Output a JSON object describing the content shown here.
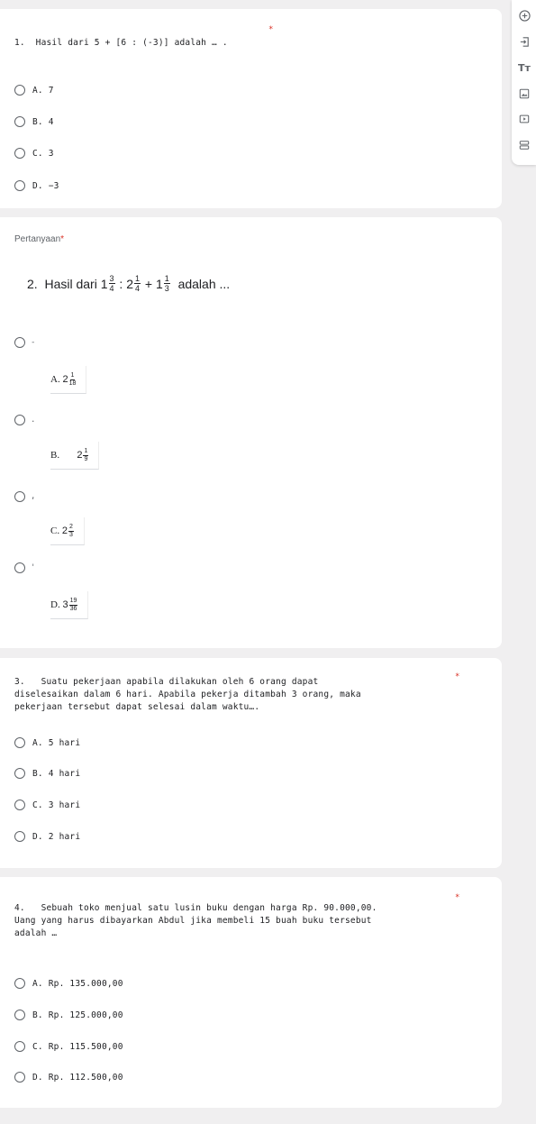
{
  "q1": {
    "text": "1.  Hasil dari 5 + [6 : (-3)] adalah … .",
    "options": [
      "A. 7",
      "B. 4",
      "C. 3",
      "D. −3"
    ]
  },
  "q2": {
    "title": "Pertanyaan",
    "required": "*",
    "stem_number": "2.",
    "stem_prefix": "Hasil dari",
    "stem_suffix": "adalah ...",
    "expr": {
      "a_whole": "1",
      "a_num": "3",
      "a_den": "4",
      "op1": ":",
      "b_whole": "2",
      "b_num": "1",
      "b_den": "4",
      "op2": "+",
      "c_whole": "1",
      "c_num": "1",
      "c_den": "3"
    },
    "options": [
      {
        "radio_label": "-",
        "letter": "A.",
        "whole": "2",
        "num": "1",
        "den": "18"
      },
      {
        "radio_label": ".",
        "letter": "B.",
        "whole": "2",
        "num": "1",
        "den": "9"
      },
      {
        "radio_label": ",",
        "letter": "C.",
        "whole": "2",
        "num": "2",
        "den": "3"
      },
      {
        "radio_label": "'",
        "letter": "D.",
        "whole": "3",
        "num": "19",
        "den": "36"
      }
    ]
  },
  "q3": {
    "text": "3.   Suatu pekerjaan apabila dilakukan oleh 6 orang dapat\ndiselesaikan dalam 6 hari. Apabila pekerja ditambah 3 orang, maka\npekerjaan tersebut dapat selesai dalam waktu….",
    "required": "*",
    "options": [
      "A. 5 hari",
      "B. 4 hari",
      "C. 3 hari",
      "D. 2 hari"
    ]
  },
  "q4": {
    "text": "4.   Sebuah toko menjual satu lusin buku dengan harga Rp. 90.000,00.\nUang yang harus dibayarkan Abdul jika membeli 15 buah buku tersebut\nadalah …",
    "required": "*",
    "options": [
      "A. Rp. 135.000,00",
      "B. Rp. 125.000,00",
      "C. Rp. 115.500,00",
      "D. Rp. 112.500,00"
    ]
  },
  "q1_required": "*",
  "sidebar": {
    "icons": [
      "add-question-icon",
      "import-questions-icon",
      "add-title-icon",
      "add-image-icon",
      "add-video-icon",
      "add-section-icon"
    ],
    "title_glyph": "Tт"
  }
}
